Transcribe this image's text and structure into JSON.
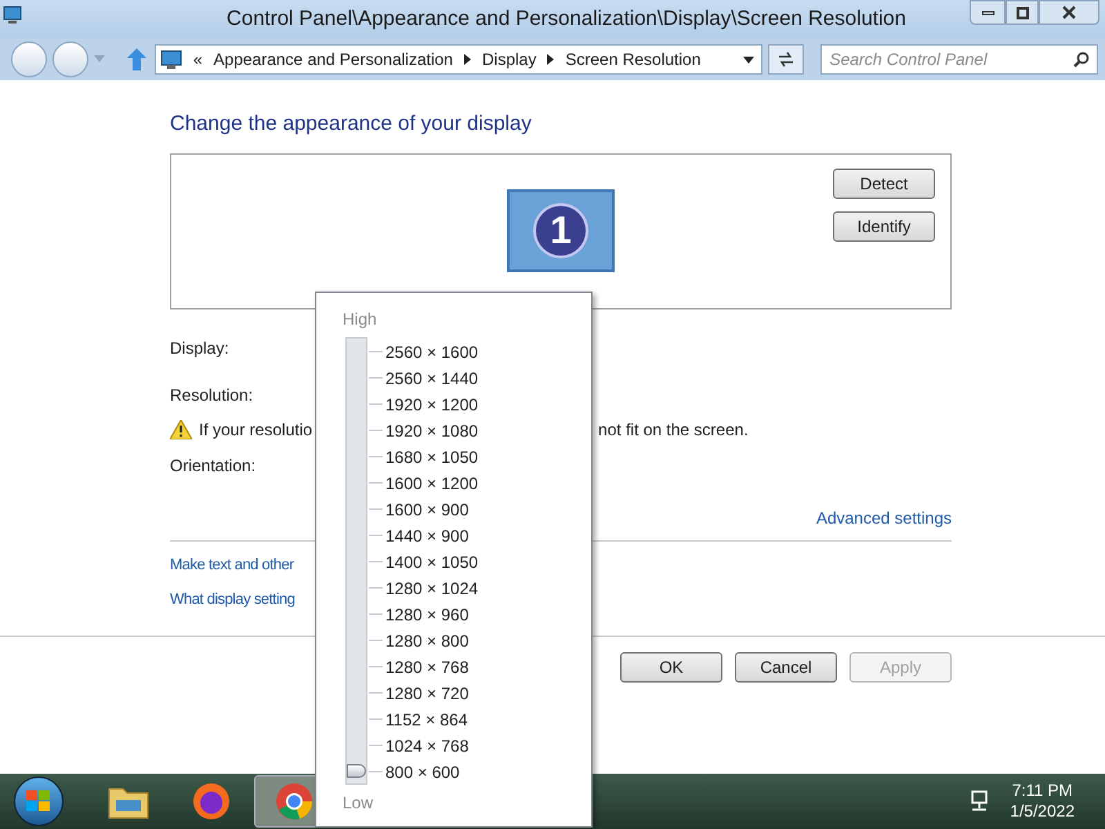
{
  "window": {
    "title": "Control Panel\\Appearance and Personalization\\Display\\Screen Resolution"
  },
  "address_bar": {
    "overflow": "«",
    "breadcrumbs": [
      "Appearance and Personalization",
      "Display",
      "Screen Resolution"
    ]
  },
  "search": {
    "placeholder": "Search Control Panel"
  },
  "heading": "Change the appearance of your display",
  "preview": {
    "monitor_number": "1",
    "buttons": [
      "Detect",
      "Identify"
    ]
  },
  "labels": [
    "Display:",
    "Resolution:"
  ],
  "warning": {
    "start": "If your resolutio",
    "end": "not fit on the screen."
  },
  "orientation_label": "Orientation:",
  "advanced_link": "Advanced settings",
  "links": [
    "Make text and other",
    "What display setting"
  ],
  "buttons": [
    {
      "label": "OK",
      "disabled": false
    },
    {
      "label": "Cancel",
      "disabled": false
    },
    {
      "label": "Apply",
      "disabled": true
    }
  ],
  "resolution_popup": {
    "high_label": "High",
    "low_label": "Low",
    "level": 0,
    "options": [
      "2560 × 1600",
      "2560 × 1440",
      "1920 × 1200",
      "1920 × 1080",
      "1680 × 1050",
      "1600 × 1200",
      "1600 × 900",
      "1440 × 900",
      "1400 × 1050",
      "1280 × 1024",
      "1280 × 960",
      "1280 × 800",
      "1280 × 768",
      "1280 × 720",
      "1152 × 864",
      "1024 × 768",
      "800 × 600"
    ]
  },
  "taskbar": {
    "apps": [
      {
        "kind": "explorer",
        "selected": false
      },
      {
        "kind": "firefox",
        "selected": false
      },
      {
        "kind": "chrome",
        "selected": true
      }
    ],
    "time": "7:11 PM",
    "date": "1/5/2022"
  }
}
